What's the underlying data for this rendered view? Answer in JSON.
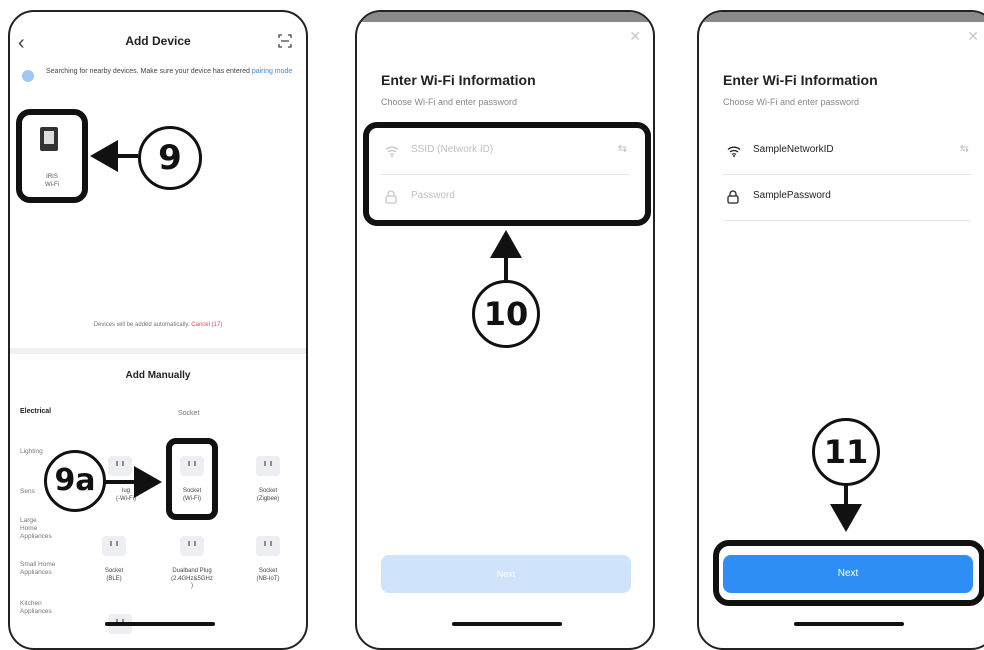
{
  "screen1": {
    "title": "Add Device",
    "search_text": "Searching for nearby devices. Make sure your device has entered",
    "search_link": "pairing mode",
    "found_device": "IRIS\nWi-Fi",
    "auto_text": "Devices will be added automatically.",
    "cancel_text": "Cancel (17)",
    "manual_title": "Add Manually",
    "categories": [
      "Electrical",
      "Lighting",
      "Sens",
      "Large\nHome\nAppliances",
      "Small Home\nAppliances",
      "Kitchen\nAppliances"
    ],
    "subcategory": "Socket",
    "sockets": [
      {
        "label": "lug\n(-Wi-Fi)"
      },
      {
        "label": "Socket\n(Wi-Fi)"
      },
      {
        "label": "Socket\n(Zigbee)"
      },
      {
        "label": "Socket\n(BLE)"
      },
      {
        "label": "Dualband Plug\n(2.4GHz&5GHz\n)"
      },
      {
        "label": "Socket\n(NB-IoT)"
      }
    ]
  },
  "screen2": {
    "title": "Enter Wi-Fi Information",
    "subtitle": "Choose Wi-Fi and enter password",
    "ssid_placeholder": "SSID (Network ID)",
    "password_placeholder": "Password",
    "next_label": "Next"
  },
  "screen3": {
    "title": "Enter Wi-Fi Information",
    "subtitle": "Choose Wi-Fi and enter password",
    "ssid_value": "SampleNetworkID",
    "password_value": "SamplePassword",
    "next_label": "Next"
  },
  "steps": {
    "s9": "9",
    "s9a": "9a",
    "s10": "10",
    "s11": "11"
  },
  "colors": {
    "accent": "#2f8ef5",
    "disabled": "#cfe4fb",
    "cancel": "#e04b4b",
    "link": "#3a8bd8"
  }
}
